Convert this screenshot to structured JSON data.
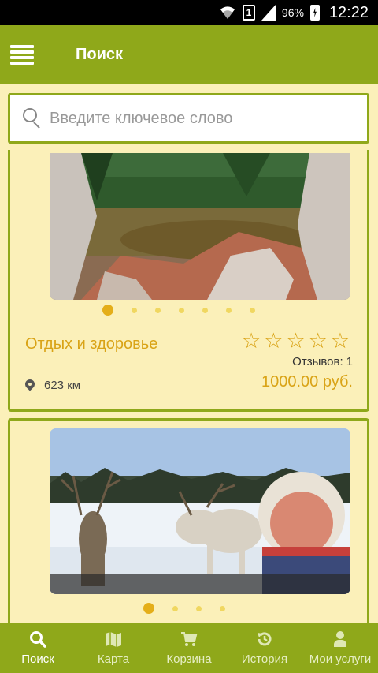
{
  "status_bar": {
    "sim_label": "1",
    "battery_percent": "96%",
    "time": "12:22"
  },
  "app_bar": {
    "title": "Поиск"
  },
  "search": {
    "placeholder": "Введите ключевое слово"
  },
  "cards": [
    {
      "title": "Отдых и здоровье",
      "rating_stars": 0,
      "stars_total": 5,
      "reviews_label": "Отзывов:",
      "reviews_count": "1",
      "distance": "623 км",
      "price": "1000.00 руб.",
      "carousel_pages": 7,
      "carousel_active": 0
    },
    {
      "carousel_pages": 4,
      "carousel_active": 0
    }
  ],
  "bottom_nav": [
    {
      "label": "Поиск",
      "icon": "search-icon",
      "active": true
    },
    {
      "label": "Карта",
      "icon": "map-icon",
      "active": false
    },
    {
      "label": "Корзина",
      "icon": "cart-icon",
      "active": false
    },
    {
      "label": "История",
      "icon": "history-icon",
      "active": false
    },
    {
      "label": "Мои услуги",
      "icon": "user-icon",
      "active": false
    }
  ],
  "colors": {
    "primary_green": "#8fa81a",
    "background_cream": "#fbf0b9",
    "accent_gold": "#d9a316"
  }
}
